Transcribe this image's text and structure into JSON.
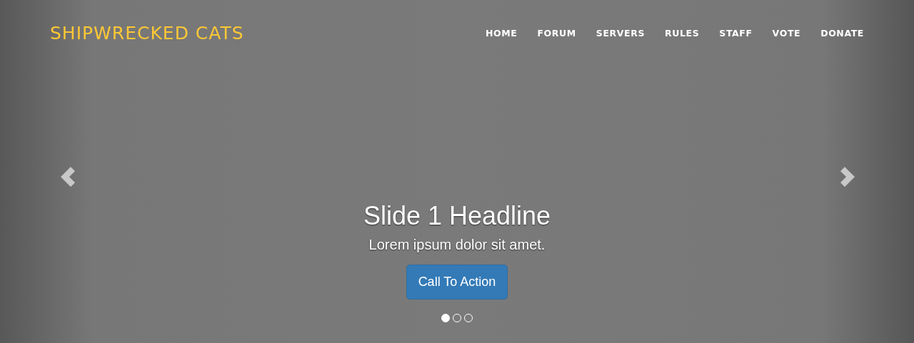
{
  "brand": "SHIPWRECKED CATS",
  "nav": [
    {
      "label": "HOME"
    },
    {
      "label": "FORUM"
    },
    {
      "label": "SERVERS"
    },
    {
      "label": "RULES"
    },
    {
      "label": "STAFF"
    },
    {
      "label": "VOTE"
    },
    {
      "label": "DONATE"
    }
  ],
  "carousel": {
    "headline": "Slide 1 Headline",
    "text": "Lorem ipsum dolor sit amet.",
    "button": "Call To Action",
    "indicators": [
      {
        "selected": true
      },
      {
        "selected": false
      },
      {
        "selected": false
      }
    ]
  }
}
